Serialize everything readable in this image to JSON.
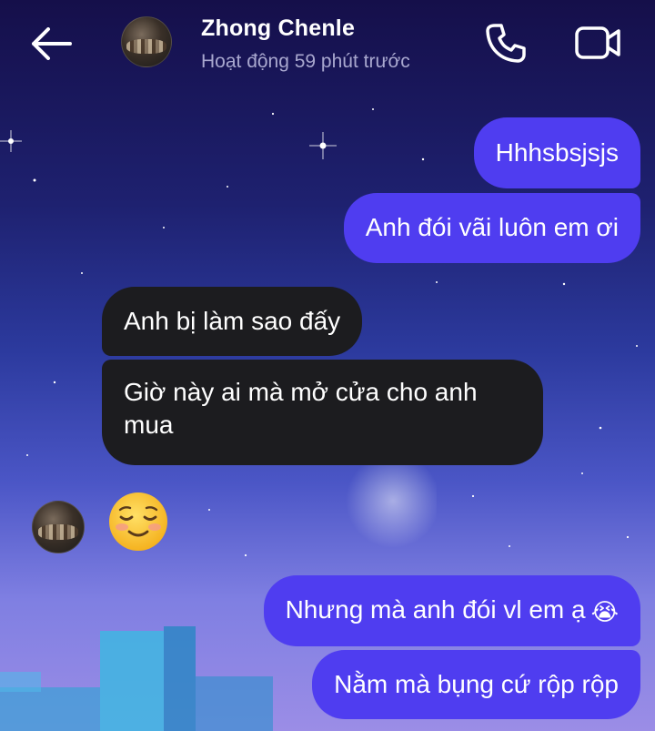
{
  "header": {
    "contact_name": "Zhong Chenle",
    "status": "Hoạt động 59 phút trước",
    "icons": {
      "back": "arrow-left-icon",
      "call": "phone-icon",
      "video": "video-camera-icon"
    }
  },
  "messages": [
    {
      "direction": "sent",
      "text": "Hhhsbsjsjs"
    },
    {
      "direction": "sent",
      "text": "Anh đói vãi luôn em ơi"
    },
    {
      "direction": "received",
      "text": "Anh bị làm sao đấy"
    },
    {
      "direction": "received",
      "line1": "Giờ này ai mà mở cửa cho anh",
      "line2": "mua"
    },
    {
      "direction": "received",
      "emoji": "smiling-face-emoji"
    },
    {
      "direction": "sent",
      "text": "Nhưng mà anh đói vl em ạ",
      "emoji": "😭"
    },
    {
      "direction": "sent",
      "text": "Nằm mà bụng cứ rộp rộp"
    }
  ],
  "colors": {
    "sent_bubble": "#4f3df0",
    "received_bubble": "#1c1c1f",
    "background_top": "#150f4a",
    "background_bottom": "#9b8de6"
  }
}
